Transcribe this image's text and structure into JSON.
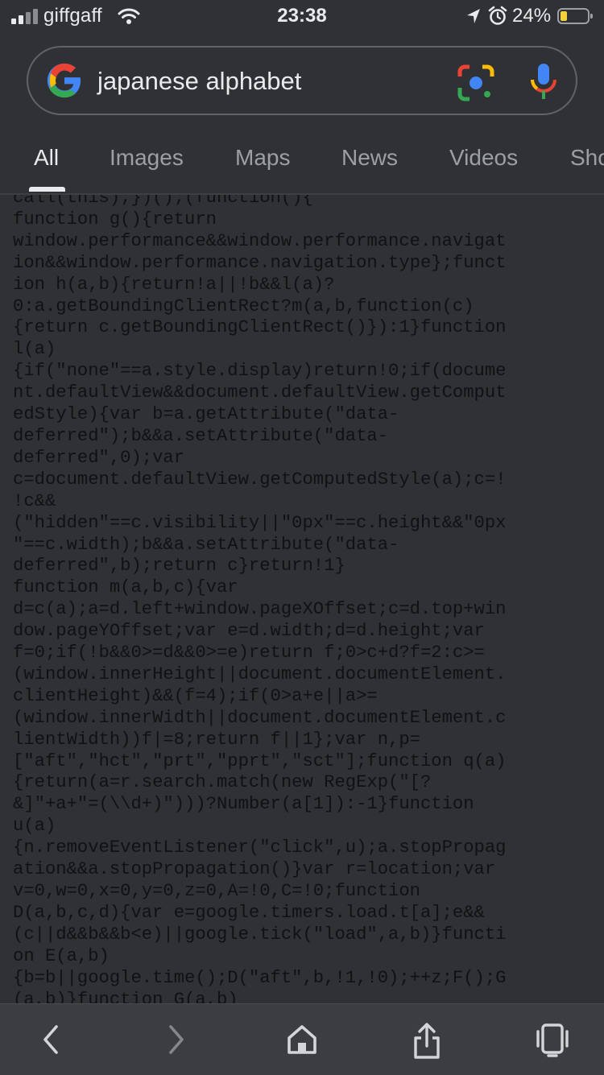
{
  "status_bar": {
    "carrier": "giffgaff",
    "time": "23:38",
    "battery_percent": "24%",
    "battery_level": 0.24,
    "signal_bars": 2,
    "icons": [
      "wifi-icon",
      "location-arrow-icon",
      "alarm-icon",
      "battery-icon"
    ]
  },
  "search": {
    "query": "japanese alphabet",
    "icons": [
      "google-g-icon",
      "google-lens-icon",
      "microphone-icon"
    ]
  },
  "tabs": [
    {
      "label": "All",
      "active": true
    },
    {
      "label": "Images",
      "active": false
    },
    {
      "label": "Maps",
      "active": false
    },
    {
      "label": "News",
      "active": false
    },
    {
      "label": "Videos",
      "active": false
    },
    {
      "label": "Sho",
      "active": false
    }
  ],
  "code_lines": [
    "call(this);})();(function(){",
    "function g(){return",
    "window.performance&&window.performance.navigat",
    "ion&&window.performance.navigation.type};funct",
    "ion h(a,b){return!a||!b&&l(a)?",
    "0:a.getBoundingClientRect?m(a,b,function(c)",
    "{return c.getBoundingClientRect()}):1}function",
    "l(a)",
    "{if(\"none\"==a.style.display)return!0;if(docume",
    "nt.defaultView&&document.defaultView.getComput",
    "edStyle){var b=a.getAttribute(\"data-",
    "deferred\");b&&a.setAttribute(\"data-",
    "deferred\",0);var",
    "c=document.defaultView.getComputedStyle(a);c=!",
    "!c&&",
    "(\"hidden\"==c.visibility||\"0px\"==c.height&&\"0px",
    "\"==c.width);b&&a.setAttribute(\"data-",
    "deferred\",b);return c}return!1}",
    "function m(a,b,c){var",
    "d=c(a);a=d.left+window.pageXOffset;c=d.top+win",
    "dow.pageYOffset;var e=d.width;d=d.height;var",
    "f=0;if(!b&&0>=d&&0>=e)return f;0>c+d?f=2:c>=",
    "(window.innerHeight||document.documentElement.",
    "clientHeight)&&(f=4);if(0>a+e||a>=",
    "(window.innerWidth||document.documentElement.c",
    "lientWidth))f|=8;return f||1};var n,p=",
    "[\"aft\",\"hct\",\"prt\",\"pprt\",\"sct\"];function q(a)",
    "{return(a=r.search.match(new RegExp(\"[?",
    "&]\"+a+\"=(\\\\d+)\")))?Number(a[1]):-1}function",
    "u(a)",
    "{n.removeEventListener(\"click\",u);a.stopPropag",
    "ation&&a.stopPropagation()}var r=location;var",
    "v=0,w=0,x=0,y=0,z=0,A=!0,C=!0;function",
    "D(a,b,c,d){var e=google.timers.load.t[a];e&&",
    "(c||d&&b&&b<e)||google.tick(\"load\",a,b)}functi",
    "on E(a,b)",
    "{b=b||google.time();D(\"aft\",b,!1,!0);++z;F();G",
    "(a,b)}function G(a,b)"
  ],
  "toolbar": {
    "icons": [
      "back-icon",
      "forward-icon",
      "home-icon",
      "share-icon",
      "tabs-icon"
    ]
  }
}
